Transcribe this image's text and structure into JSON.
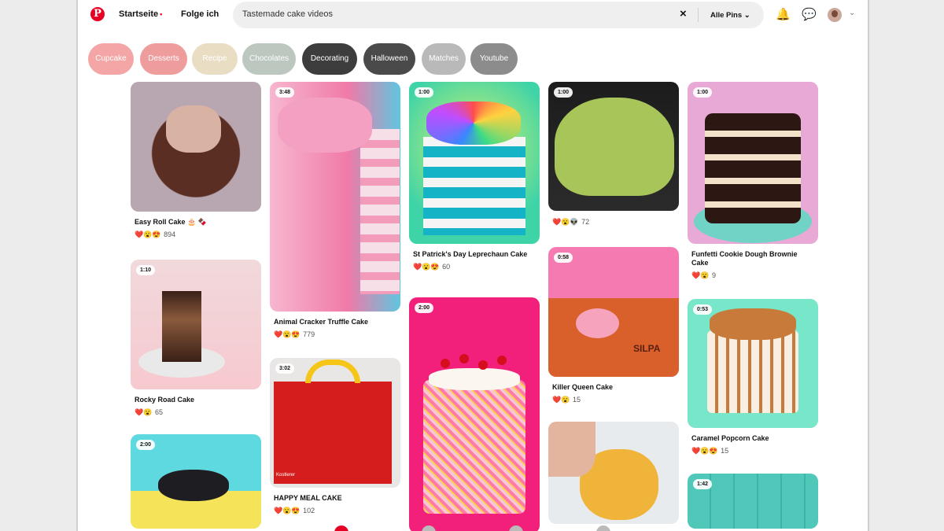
{
  "nav": {
    "home": "Startseite",
    "home_dot": "•",
    "follow": "Folge ich"
  },
  "search": {
    "query": "Tastemade cake videos",
    "clear_icon": "×",
    "scope": "Alle Pins",
    "scope_icon": "⌄"
  },
  "header_icons": {
    "logo": "P",
    "bell": "🔔",
    "messages": "💬",
    "account_caret": "⌄"
  },
  "chips": [
    {
      "label": "Cupcake",
      "color": "#f4a6a6"
    },
    {
      "label": "Desserts",
      "color": "#ee9c9c"
    },
    {
      "label": "Recipe",
      "color": "#e9dec4"
    },
    {
      "label": "Chocolates",
      "color": "#bcc8bf"
    },
    {
      "label": "Decorating",
      "color": "#3d3d3d"
    },
    {
      "label": "Halloween",
      "color": "#4a4a4a"
    },
    {
      "label": "Matches",
      "color": "#b9b9b9"
    },
    {
      "label": "Youtube",
      "color": "#8c8c8c"
    }
  ],
  "pins": [
    {
      "title": "Easy Roll Cake 🎂 🍫",
      "duration": "",
      "reactions": "❤️😮😍",
      "count": "894"
    },
    {
      "title": "Rocky Road Cake",
      "duration": "1:10",
      "reactions": "❤️😮",
      "count": "65"
    },
    {
      "title": "",
      "duration": "2:00",
      "reactions": "",
      "count": ""
    },
    {
      "title": "Animal Cracker Truffle Cake",
      "duration": "3:48",
      "reactions": "❤️😮😍",
      "count": "779"
    },
    {
      "title": "HAPPY MEAL CAKE",
      "duration": "3:02",
      "reactions": "❤️😮😍",
      "count": "102"
    },
    {
      "title": "St Patrick's Day Leprechaun Cake",
      "duration": "1:00",
      "reactions": "❤️😮😍",
      "count": "60"
    },
    {
      "title": "",
      "duration": "2:00",
      "reactions": "",
      "count": ""
    },
    {
      "title": "",
      "duration": "1:00",
      "reactions": "❤️😮👽",
      "count": "72"
    },
    {
      "title": "Killer Queen Cake",
      "duration": "0:58",
      "reactions": "❤️😮",
      "count": "15"
    },
    {
      "title": "",
      "duration": "",
      "reactions": "",
      "count": ""
    },
    {
      "title": "Funfetti Cookie Dough Brownie Cake",
      "duration": "1:00",
      "reactions": "❤️😮",
      "count": "9"
    },
    {
      "title": "Caramel Popcorn Cake",
      "duration": "0:53",
      "reactions": "❤️😮😍",
      "count": "15"
    },
    {
      "title": "",
      "duration": "1:42",
      "reactions": "",
      "count": ""
    }
  ],
  "happy_meal_badge": "Kostlerer",
  "sign": "SILPA"
}
